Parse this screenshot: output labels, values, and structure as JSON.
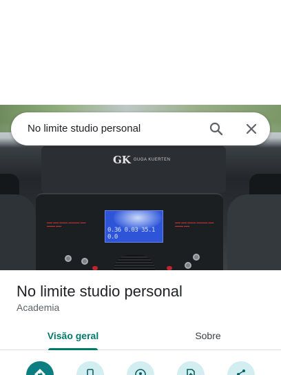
{
  "search": {
    "query": "No limite studio personal"
  },
  "photo": {
    "brand_mark": "GK",
    "brand_name": "GUGA KUERTEN",
    "display_readout": "0.36  0.03  35.1  0.0"
  },
  "place": {
    "name": "No limite studio personal",
    "category": "Academia"
  },
  "tabs": [
    {
      "label": "Visão geral",
      "active": true
    },
    {
      "label": "Sobre",
      "active": false
    }
  ],
  "actions": [
    {
      "icon": "directions-icon"
    },
    {
      "icon": "phone-icon"
    },
    {
      "icon": "location-icon"
    },
    {
      "icon": "save-icon"
    },
    {
      "icon": "share-icon"
    }
  ],
  "colors": {
    "accent": "#00796b",
    "action_primary": "#0a7e80",
    "action_secondary": "#d3eef0"
  }
}
